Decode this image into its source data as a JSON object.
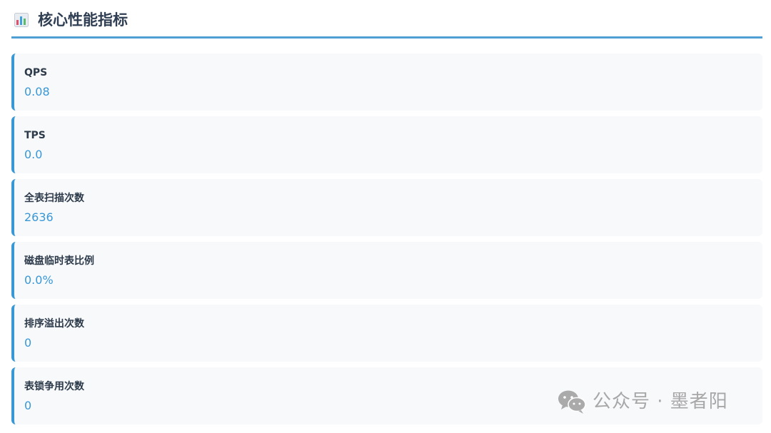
{
  "section": {
    "icon": "bar-chart-icon",
    "title": "核心性能指标"
  },
  "metrics": [
    {
      "label": "QPS",
      "value": "0.08"
    },
    {
      "label": "TPS",
      "value": "0.0"
    },
    {
      "label": "全表扫描次数",
      "value": "2636"
    },
    {
      "label": "磁盘临时表比例",
      "value": "0.0%"
    },
    {
      "label": "排序溢出次数",
      "value": "0"
    },
    {
      "label": "表锁争用次数",
      "value": "0"
    }
  ],
  "watermark": {
    "icon": "wechat-icon",
    "text": "公众号 · 墨者阳"
  },
  "colors": {
    "accent": "#3a97d6",
    "header_rule": "#4f9fd4",
    "card_bg": "#f7f9fb",
    "title_text": "#2f3e52"
  }
}
